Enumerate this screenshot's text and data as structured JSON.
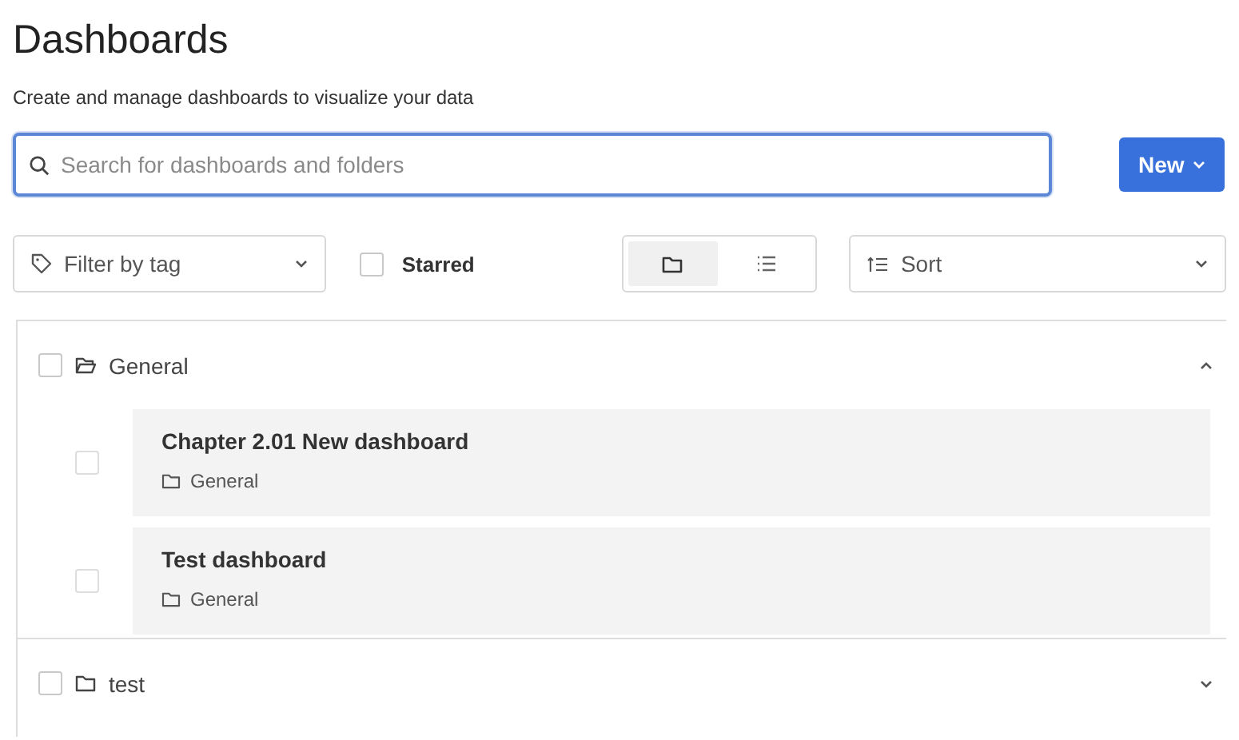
{
  "page": {
    "title": "Dashboards",
    "subtitle": "Create and manage dashboards to visualize your data"
  },
  "search": {
    "placeholder": "Search for dashboards and folders"
  },
  "new_button": {
    "label": "New"
  },
  "filters": {
    "tag_filter": {
      "placeholder": "Filter by tag"
    },
    "starred": {
      "label": "Starred",
      "checked": false
    },
    "view_toggle": [
      {
        "kind": "folder",
        "selected": true
      },
      {
        "kind": "list",
        "selected": false
      }
    ],
    "sort": {
      "placeholder": "Sort"
    }
  },
  "folders": [
    {
      "name": "General",
      "checked": false,
      "expanded": true,
      "children": [
        {
          "title": "Chapter 2.01 New dashboard",
          "folder": "General",
          "checked": false
        },
        {
          "title": "Test dashboard",
          "folder": "General",
          "checked": false
        }
      ]
    },
    {
      "name": "test",
      "checked": false,
      "expanded": false
    }
  ]
}
